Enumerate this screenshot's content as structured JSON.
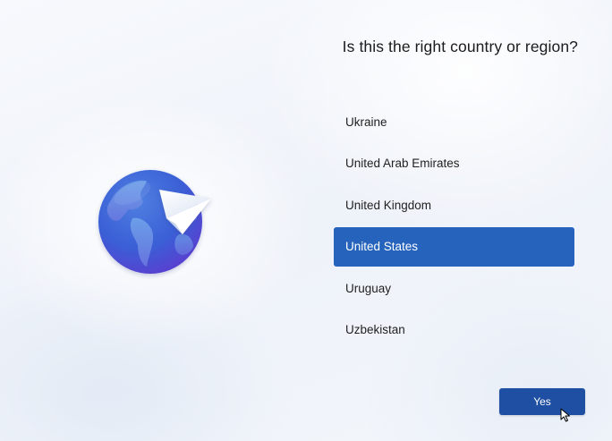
{
  "header": {
    "title": "Is this the right country or region?"
  },
  "illustration": {
    "icon": "globe-paper-plane-icon"
  },
  "country_list": {
    "items": [
      {
        "label": "Ukraine",
        "selected": false
      },
      {
        "label": "United Arab Emirates",
        "selected": false
      },
      {
        "label": "United Kingdom",
        "selected": false
      },
      {
        "label": "United States",
        "selected": true
      },
      {
        "label": "Uruguay",
        "selected": false
      },
      {
        "label": "Uzbekistan",
        "selected": false
      }
    ]
  },
  "actions": {
    "yes_label": "Yes"
  },
  "colors": {
    "accent": "#2563bd",
    "button": "#1e4fa2",
    "background": "#f3f6fb"
  }
}
